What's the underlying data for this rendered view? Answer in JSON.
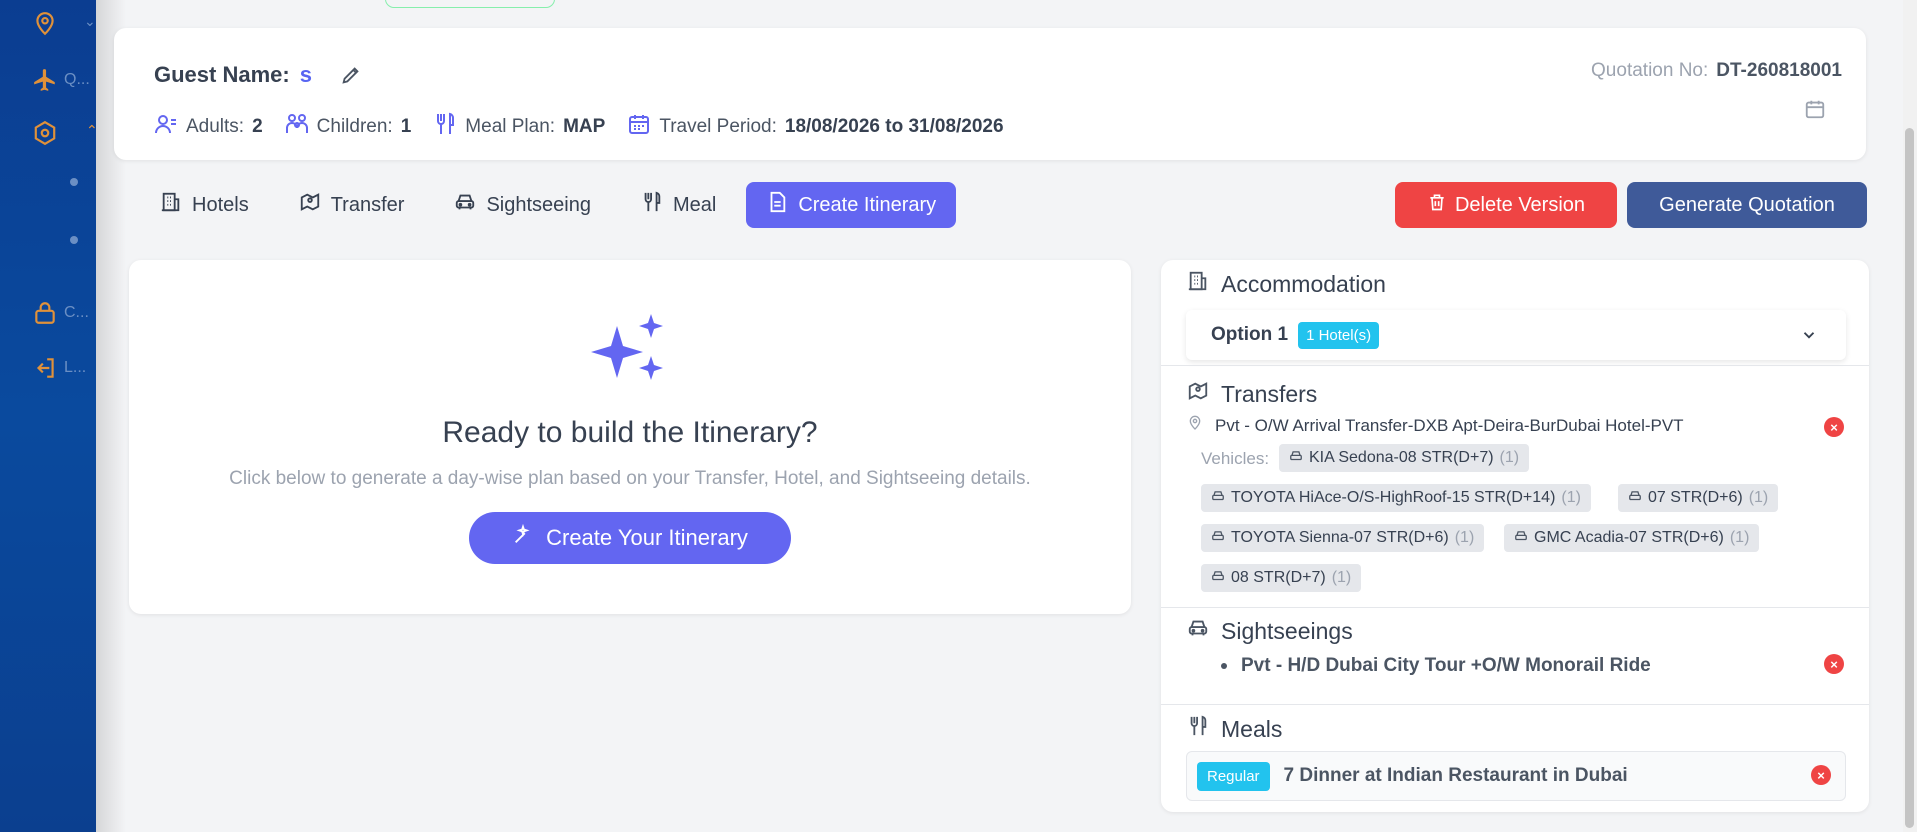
{
  "sidebar": {
    "items": [
      {
        "icon": "location-pin-icon",
        "label": ""
      },
      {
        "icon": "plane-icon",
        "label": "Q..."
      },
      {
        "icon": "hexagon-settings-icon",
        "label": ""
      },
      {
        "icon": "document-icon",
        "label": ""
      },
      {
        "icon": "circle-icon",
        "label": ""
      },
      {
        "icon": "lock-icon",
        "label": "C..."
      },
      {
        "icon": "logout-icon",
        "label": "L..."
      }
    ]
  },
  "header": {
    "guest_label": "Guest Name:",
    "guest_value": "s",
    "adults_label": "Adults:",
    "adults_value": "2",
    "children_label": "Children:",
    "children_value": "1",
    "meal_plan_label": "Meal Plan:",
    "meal_plan_value": "MAP",
    "travel_label": "Travel Period:",
    "travel_value": "18/08/2026 to 31/08/2026",
    "quotation_label": "Quotation No:",
    "quotation_value": "DT-260818001"
  },
  "tabs": [
    {
      "label": "Hotels",
      "icon": "building-icon"
    },
    {
      "label": "Transfer",
      "icon": "map-pin-icon"
    },
    {
      "label": "Sightseeing",
      "icon": "bus-icon"
    },
    {
      "label": "Meal",
      "icon": "utensils-icon"
    },
    {
      "label": "Create Itinerary",
      "icon": "document-icon",
      "active": true
    }
  ],
  "actions": {
    "delete_label": "Delete Version",
    "generate_label": "Generate Quotation"
  },
  "itinerary": {
    "title": "Ready to build the Itinerary?",
    "subtitle": "Click below to generate a day-wise plan based on your Transfer, Hotel, and Sightseeing details.",
    "button": "Create Your Itinerary"
  },
  "summary": {
    "accommodation_title": "Accommodation",
    "option_label": "Option 1",
    "option_badge": "1 Hotel(s)",
    "transfers_title": "Transfers",
    "transfer_name": "Pvt - O/W Arrival Transfer-DXB Apt-Deira-BurDubai Hotel-PVT",
    "vehicles_label": "Vehicles:",
    "vehicles": [
      {
        "name": "KIA Sedona-08 STR(D+7)",
        "count": "(1)"
      },
      {
        "name": "TOYOTA HiAce-O/S-HighRoof-15 STR(D+14)",
        "count": "(1)"
      },
      {
        "name": "07 STR(D+6)",
        "count": "(1)"
      },
      {
        "name": "TOYOTA Sienna-07 STR(D+6)",
        "count": "(1)"
      },
      {
        "name": "GMC Acadia-07 STR(D+6)",
        "count": "(1)"
      },
      {
        "name": "08 STR(D+7)",
        "count": "(1)"
      }
    ],
    "sightseeings_title": "Sightseeings",
    "sightseeing_item": "Pvt - H/D Dubai City Tour +O/W Monorail Ride",
    "meals_title": "Meals",
    "meal_badge": "Regular",
    "meal_item": "7 Dinner at Indian Restaurant in Dubai"
  }
}
